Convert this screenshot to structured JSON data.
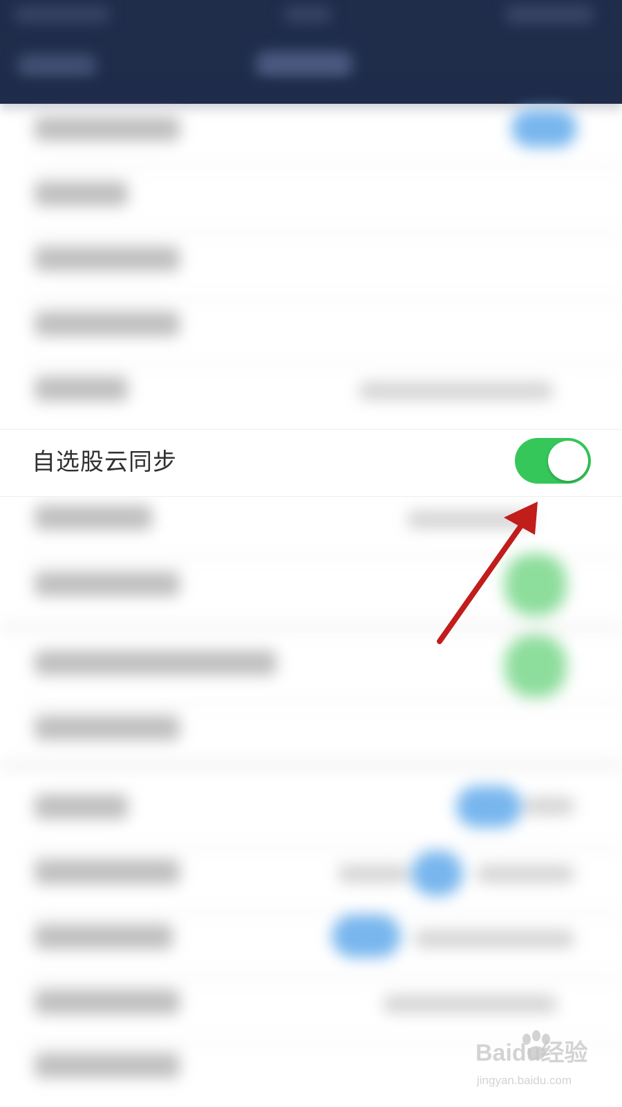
{
  "settings": {
    "cloud_sync_label": "自选股云同步",
    "cloud_sync_enabled": true
  },
  "watermark": {
    "brand": "Baidu经验",
    "url": "jingyan.baidu.com"
  },
  "colors": {
    "header_bg": "#1f2c4a",
    "toggle_on": "#35c759",
    "arrow": "#c01d1b",
    "blue_pill": "#78b6ee",
    "green_pill": "#8ddd9c"
  },
  "icons": {
    "annotation": "red-arrow-icon",
    "watermark": "baidu-paw-icon"
  }
}
